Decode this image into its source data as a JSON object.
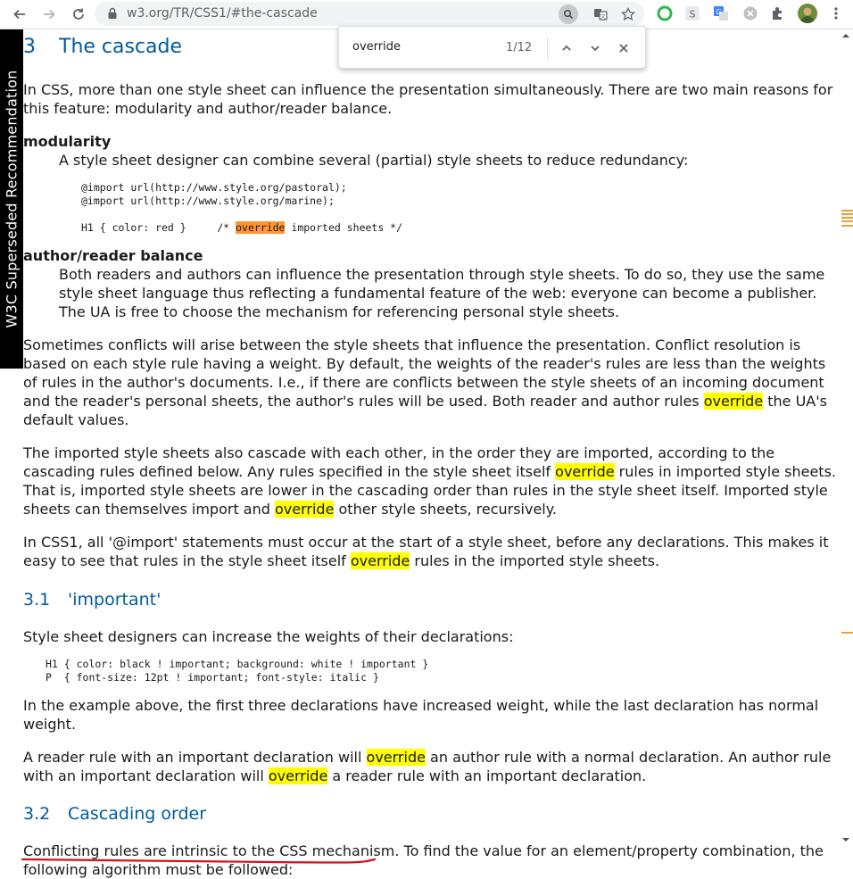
{
  "browser": {
    "url": "w3.org/TR/CSS1/#the-cascade",
    "back_icon": "arrow-left-icon",
    "forward_icon": "arrow-right-icon",
    "reload_icon": "reload-icon"
  },
  "findbar": {
    "query": "override",
    "count": "1/12"
  },
  "badge": {
    "text": "W3C Superseded Recommendation"
  },
  "sections": {
    "cascade": {
      "num": "3",
      "title": "The cascade"
    },
    "important": {
      "num": "3.1",
      "title": "'important'"
    },
    "order": {
      "num": "3.2",
      "title": "Cascading order"
    }
  },
  "text": {
    "intro": "In CSS, more than one style sheet can influence the presentation simultaneously. There are two main reasons for this feature: modularity and author/reader balance.",
    "dt_modularity": "modularity",
    "dd_modularity": "A style sheet designer can combine several (partial) style sheets to reduce redundancy:",
    "code1_line1": "@import url(http://www.style.org/pastoral);",
    "code1_line2": "@import url(http://www.style.org/marine);",
    "code1_line3_pre": "H1 { color: red }     /* ",
    "code1_line3_hl": "override",
    "code1_line3_post": " imported sheets */",
    "dt_balance": "author/reader balance",
    "dd_balance": "Both readers and authors can influence the presentation through style sheets. To do so, they use the same style sheet language thus reflecting a fundamental feature of the web: everyone can become a publisher. The UA is free to choose the mechanism for referencing personal style sheets.",
    "p1_pre": "Sometimes conflicts will arise between the style sheets that influence the presentation. Conflict resolution is based on each style rule having a weight. By default, the weights of the reader's rules are less than the weights of rules in the author's documents. I.e., if there are conflicts between the style sheets of an incoming document and the reader's personal sheets, the author's rules will be used. Both reader and author rules ",
    "p1_hl": "override",
    "p1_post": " the UA's default values.",
    "p2_a": "The imported style sheets also cascade with each other, in the order they are imported, according to the cascading rules defined below. Any rules specified in the style sheet itself ",
    "p2_hl1": "override",
    "p2_b": " rules in imported style sheets. That is, imported style sheets are lower in the cascading order than rules in the style sheet itself. Imported style sheets can themselves import and ",
    "p2_hl2": "override",
    "p2_c": " other style sheets, recursively.",
    "p3_pre": "In CSS1, all '@import' statements must occur at the start of a style sheet, before any declarations. This makes it easy to see that rules in the style sheet itself ",
    "p3_hl": "override",
    "p3_post": " rules in the imported style sheets.",
    "p4": "Style sheet designers can increase the weights of their declarations:",
    "code2_line1": "H1 { color: black ! important; background: white ! important }",
    "code2_line2": "P  { font-size: 12pt ! important; font-style: italic }",
    "p5": "In the example above, the first three declarations have increased weight, while the last declaration has normal weight.",
    "p6_a": "A reader rule with an important declaration will ",
    "p6_hl1": "override",
    "p6_b": " an author rule with a normal declaration. An author rule with an important declaration will ",
    "p6_hl2": "override",
    "p6_c": " a reader rule with an important declaration.",
    "p7_underlined": "Conflicting rules are intrinsic to the CSS mechanism",
    "p7_rest": ". To find the value for an element/property combination, the following algorithm must be followed:"
  },
  "colors": {
    "heading": "#005a9c",
    "highlight": "#ffff00",
    "current_highlight": "#ff9632",
    "ink": "#d9101a"
  }
}
